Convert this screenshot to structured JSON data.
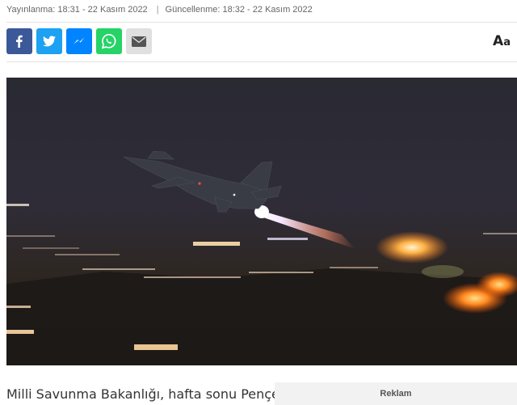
{
  "meta": {
    "published": "Yayınlanma: 18:31 - 22 Kasım 2022",
    "separator": "|",
    "updated": "Güncellenme: 18:32 - 22 Kasım 2022"
  },
  "share": {
    "buttons": [
      {
        "icon": "facebook-icon",
        "color": "#3b5998"
      },
      {
        "icon": "twitter-icon",
        "color": "#1da1f2"
      },
      {
        "icon": "messenger-icon",
        "color": "#0084ff"
      },
      {
        "icon": "whatsapp-icon",
        "color": "#25d366"
      },
      {
        "icon": "mail-icon",
        "color": "#e0e0e0"
      }
    ]
  },
  "font_toggle": {
    "big": "A",
    "small": "a"
  },
  "article": {
    "lead": "Milli Savunma Bakanlığı, hafta sonu Pençe"
  },
  "ad": {
    "label": "Reklam"
  }
}
